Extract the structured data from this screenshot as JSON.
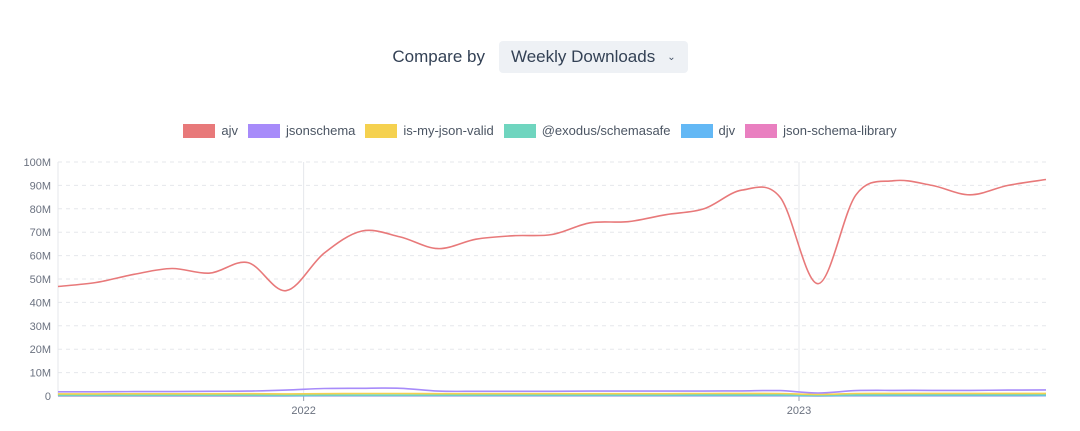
{
  "compare": {
    "label": "Compare by",
    "selected": "Weekly Downloads",
    "chevron_icon": "chevron-down-icon"
  },
  "chart_data": {
    "type": "line",
    "title": "",
    "xlabel": "",
    "ylabel": "",
    "ylim": [
      0,
      100000000
    ],
    "y_ticks": [
      "0",
      "10M",
      "20M",
      "30M",
      "40M",
      "50M",
      "60M",
      "70M",
      "80M",
      "90M",
      "100M"
    ],
    "x_ticks": [
      "2022",
      "2023"
    ],
    "grid": true,
    "legend_position": "top-center",
    "x": [
      "2021-07-04",
      "2021-08-01",
      "2021-08-29",
      "2021-09-26",
      "2021-10-24",
      "2021-11-21",
      "2021-12-19",
      "2022-01-16",
      "2022-02-13",
      "2022-03-13",
      "2022-04-10",
      "2022-05-08",
      "2022-06-05",
      "2022-07-03",
      "2022-07-31",
      "2022-08-28",
      "2022-09-25",
      "2022-10-23",
      "2022-11-20",
      "2022-12-18",
      "2023-01-15",
      "2023-02-12",
      "2023-03-12",
      "2023-04-09",
      "2023-05-07",
      "2023-06-04",
      "2023-07-02"
    ],
    "series": [
      {
        "name": "ajv",
        "color": "#e8797a",
        "values": [
          46800000,
          48500000,
          52000000,
          54500000,
          52500000,
          57000000,
          45000000,
          61000000,
          70500000,
          68000000,
          63000000,
          67000000,
          68500000,
          69000000,
          74000000,
          74500000,
          77500000,
          80000000,
          88000000,
          85000000,
          48000000,
          86000000,
          92000000,
          90000000,
          86000000,
          90000000,
          92500000
        ]
      },
      {
        "name": "jsonschema",
        "color": "#a78bfa",
        "values": [
          1800000,
          1800000,
          1900000,
          1900000,
          2000000,
          2100000,
          2500000,
          3200000,
          3300000,
          3300000,
          2100000,
          2000000,
          2000000,
          2000000,
          2100000,
          2100000,
          2100000,
          2100000,
          2200000,
          2300000,
          1300000,
          2300000,
          2400000,
          2400000,
          2400000,
          2500000,
          2600000
        ]
      },
      {
        "name": "is-my-json-valid",
        "color": "#f5d14f",
        "values": [
          900000,
          900000,
          950000,
          950000,
          950000,
          1000000,
          900000,
          1000000,
          1050000,
          1050000,
          1000000,
          1000000,
          1000000,
          1000000,
          1000000,
          1000000,
          1000000,
          1050000,
          1100000,
          1050000,
          700000,
          1050000,
          1100000,
          1100000,
          1100000,
          1100000,
          1100000
        ]
      },
      {
        "name": "@exodus/schemasafe",
        "color": "#6fd5bf",
        "values": [
          300000,
          300000,
          300000,
          350000,
          350000,
          350000,
          300000,
          400000,
          400000,
          400000,
          400000,
          400000,
          450000,
          450000,
          450000,
          450000,
          450000,
          500000,
          500000,
          500000,
          300000,
          500000,
          550000,
          550000,
          550000,
          550000,
          600000
        ]
      },
      {
        "name": "djv",
        "color": "#63b8f5",
        "values": [
          150000,
          150000,
          150000,
          150000,
          150000,
          150000,
          120000,
          150000,
          150000,
          150000,
          150000,
          150000,
          150000,
          150000,
          150000,
          150000,
          150000,
          150000,
          150000,
          150000,
          100000,
          150000,
          150000,
          150000,
          150000,
          150000,
          150000
        ]
      },
      {
        "name": "json-schema-library",
        "color": "#e97fc0",
        "values": [
          50000,
          50000,
          50000,
          60000,
          60000,
          60000,
          50000,
          70000,
          70000,
          70000,
          70000,
          70000,
          80000,
          80000,
          80000,
          80000,
          80000,
          90000,
          90000,
          90000,
          60000,
          100000,
          100000,
          100000,
          100000,
          100000,
          110000
        ]
      }
    ]
  }
}
